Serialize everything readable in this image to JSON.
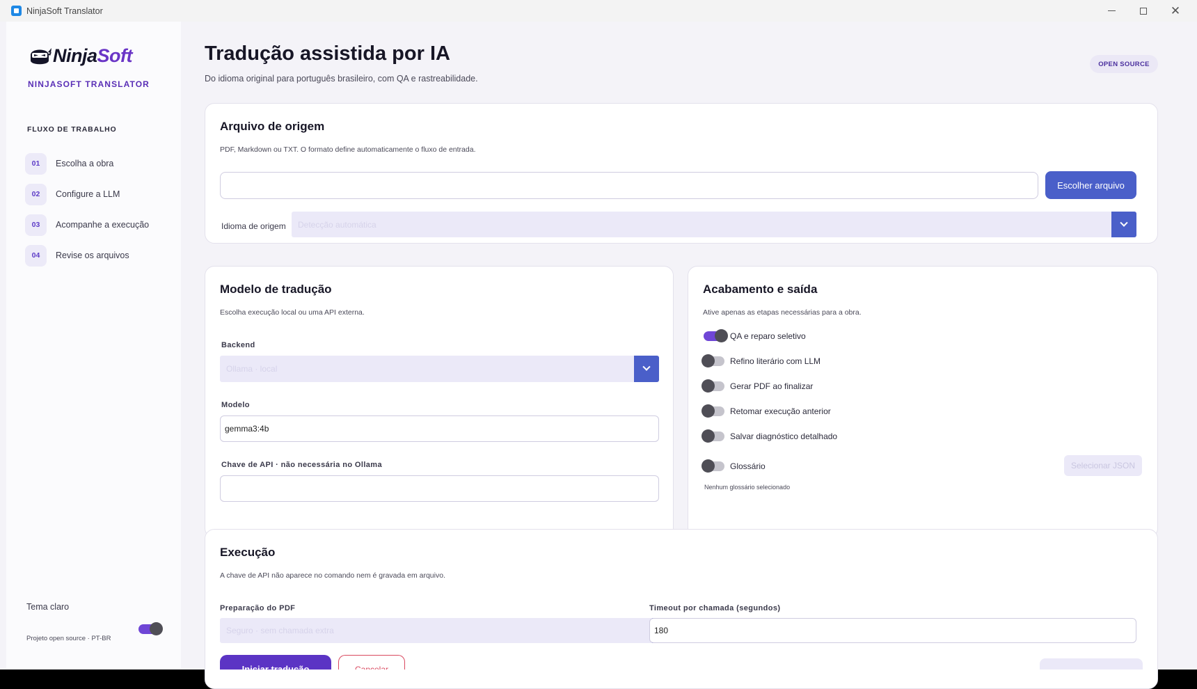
{
  "window": {
    "title": "NinjaSoft Translator"
  },
  "sidebar": {
    "logo_ninja": "Ninja",
    "logo_soft": "Soft",
    "brand": "NINJASOFT TRANSLATOR",
    "workflow_title": "FLUXO DE TRABALHO",
    "steps": [
      {
        "num": "01",
        "label": "Escolha a obra"
      },
      {
        "num": "02",
        "label": "Configure a LLM"
      },
      {
        "num": "03",
        "label": "Acompanhe a execução"
      },
      {
        "num": "04",
        "label": "Revise os arquivos"
      }
    ],
    "theme_label": "Tema claro",
    "theme_on": true,
    "footer": "Projeto open source · PT-BR"
  },
  "header": {
    "title": "Tradução assistida por IA",
    "subtitle": "Do idioma original para português brasileiro, com QA e rastreabilidade.",
    "badge": "OPEN SOURCE"
  },
  "source": {
    "title": "Arquivo de origem",
    "subtitle": "PDF, Markdown ou TXT. O formato define automaticamente o fluxo de entrada.",
    "file_value": "",
    "choose_button": "Escolher arquivo",
    "language_label": "Idioma de origem",
    "language_value": "Detecção automática"
  },
  "model": {
    "title": "Modelo de tradução",
    "subtitle": "Escolha execução local ou uma API externa.",
    "backend_label": "Backend",
    "backend_value": "Ollama · local",
    "model_label": "Modelo",
    "model_value": "gemma3:4b",
    "apikey_label": "Chave de API · não necessária no Ollama",
    "apikey_value": ""
  },
  "output": {
    "title": "Acabamento e saída",
    "subtitle": "Ative apenas as etapas necessárias para a obra.",
    "options": [
      {
        "label": "QA e reparo seletivo",
        "on": true
      },
      {
        "label": "Refino literário com LLM",
        "on": false
      },
      {
        "label": "Gerar PDF ao finalizar",
        "on": false
      },
      {
        "label": "Retomar execução anterior",
        "on": false
      },
      {
        "label": "Salvar diagnóstico detalhado",
        "on": false
      }
    ],
    "glossary_label": "Glossário",
    "glossary_on": false,
    "glossary_button": "Selecionar JSON",
    "glossary_note": "Nenhum glossário selecionado"
  },
  "execution": {
    "title": "Execução",
    "subtitle": "A chave de API não aparece no comando nem é gravada em arquivo.",
    "pdf_prep_label": "Preparação do PDF",
    "pdf_prep_value": "Seguro · sem chamada extra",
    "timeout_label": "Timeout por chamada (segundos)",
    "timeout_value": "180",
    "start_button": "Iniciar tradução",
    "cancel_button": "Cancelar"
  },
  "colors": {
    "accent": "#4a5fc9",
    "brand": "#5b34c4",
    "danger": "#d9485f"
  }
}
